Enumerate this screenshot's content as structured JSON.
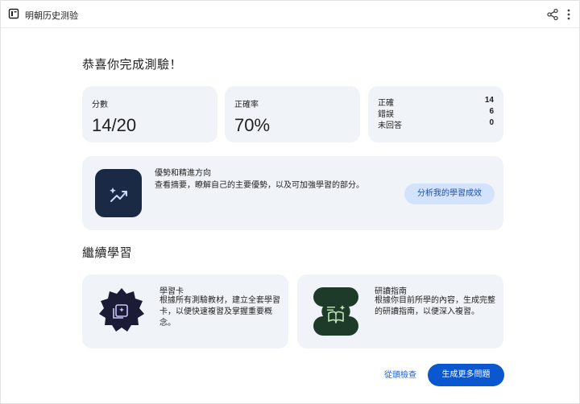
{
  "app": {
    "title": "明朝历史测验"
  },
  "heading": "恭喜你完成測驗！",
  "stats": {
    "score_label": "分數",
    "score_value": "14/20",
    "accuracy_label": "正確率",
    "accuracy_value": "70%"
  },
  "breakdown": [
    {
      "label": "正確",
      "value": "14"
    },
    {
      "label": "錯誤",
      "value": "6"
    },
    {
      "label": "未回答",
      "value": "0"
    }
  ],
  "insight": {
    "title": "優勢和精進方向",
    "description": "查看摘要，瞭解自己的主要優勢，以及可加強學習的部分。",
    "button_label": "分析我的學習成效"
  },
  "section_title": "繼續學習",
  "resources": [
    {
      "title": "學習卡",
      "description_lines": [
        "根據所有測驗教材，建立全套學習",
        "卡，以便快速複習及掌握重要概",
        "念。"
      ],
      "icon": "flashcards-icon"
    },
    {
      "title": "研讀指南",
      "description_lines": [
        "根據你目前所學的內容，生成完整",
        "的研讀指南，以便深入複習。"
      ],
      "icon": "study-guide-icon"
    }
  ],
  "actions": {
    "review_label": "從頭檢查",
    "more_label": "生成更多問題"
  },
  "colors": {
    "card_bg": "#f0f4f9",
    "primary": "#0b57d0",
    "tonal": "#d3e3fd"
  }
}
